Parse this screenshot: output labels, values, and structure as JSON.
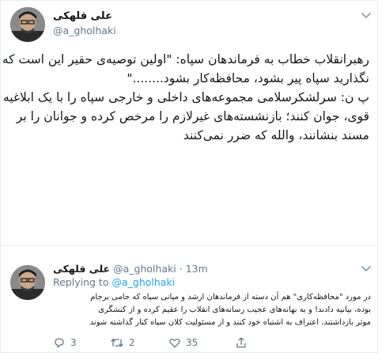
{
  "main_tweet": {
    "author_name": "علی قلهکی",
    "author_handle": "@a_gholhaki",
    "text_lines": [
      "رهبرانقلاب خطاب به فرماندهان سپاه: \"اولین توصیه‌ی حقیر این است که",
      "نگذارید سپاه پیر بشود، محافظه‌کار بشود........\"",
      "پ ن: سرلشکرسلامی مجموعه‌های داخلی و خارجی سپاه را با یک ابلاغیه",
      "قوی، جوان کنند؛ بازنشسته‌های غیرلازم را مرخص کرده و جوانان را بر",
      "مسند بنشانند، والله که ضرر نمی‌کنند"
    ]
  },
  "reply_tweet": {
    "author_name": "علی قلهکی",
    "author_handle": "@a_gholhaki",
    "separator": "·",
    "time": "13m",
    "replying_label": "Replying to",
    "replying_handle": "@a_gholhaki",
    "text_lines": [
      "در مورد \"محافظه‌کاری\" هم آن دسته از فرماندهان ارشد و میانی سپاه که حامی برجام",
      "بوده، بیانیه دادند! و به بهانه‌های عجیب رسانه‌های انقلاب را عقیم کرده و از کنشگری",
      "موثر بازداشتند، اعتراف به اشتباه خود کنند و از مسئولیت کلان سپاه کنار گذاشته شوند"
    ],
    "actions": {
      "reply_count": "3",
      "retweet_count": "2",
      "like_count": "35"
    }
  },
  "icons": {
    "reply": "reply-icon",
    "retweet": "retweet-icon",
    "like": "heart-icon",
    "share": "share-icon",
    "more": "chevron-down-icon"
  },
  "colors": {
    "accent": "#1da1f2",
    "muted": "#657786",
    "text": "#14171a"
  }
}
